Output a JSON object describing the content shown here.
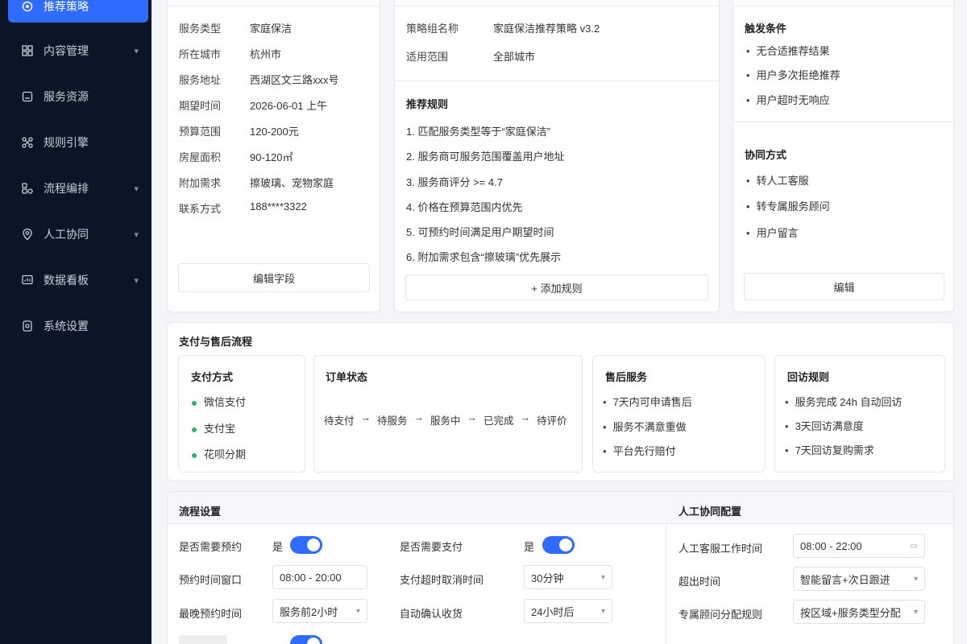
{
  "sidebar": {
    "active": {
      "label": "推荐策略",
      "icon": "strategy-icon"
    },
    "items": [
      {
        "label": "内容管理",
        "icon": "grid-icon",
        "has_children": true
      },
      {
        "label": "服务资源",
        "icon": "resource-icon",
        "has_children": false
      },
      {
        "label": "规则引擎",
        "icon": "rule-engine-icon",
        "has_children": false
      },
      {
        "label": "流程编排",
        "icon": "flow-icon",
        "has_children": true
      },
      {
        "label": "人工协同",
        "icon": "location-icon",
        "has_children": true
      },
      {
        "label": "数据看板",
        "icon": "dashboard-icon",
        "has_children": true
      },
      {
        "label": "系统设置",
        "icon": "settings-icon",
        "has_children": false
      }
    ]
  },
  "request": {
    "fields": [
      {
        "k": "服务类型",
        "v": "家庭保洁"
      },
      {
        "k": "所在城市",
        "v": "杭州市"
      },
      {
        "k": "服务地址",
        "v": "西湖区文三路xxx号"
      },
      {
        "k": "期望时间",
        "v": "2026-06-01 上午"
      },
      {
        "k": "预算范围",
        "v": "120-200元"
      },
      {
        "k": "房屋面积",
        "v": "90-120㎡"
      },
      {
        "k": "附加需求",
        "v": "擦玻璃、宠物家庭"
      },
      {
        "k": "联系方式",
        "v": "188****3322"
      }
    ],
    "edit_button": "编辑字段"
  },
  "strategy": {
    "name_label": "策略组名称",
    "name_value": "家庭保洁推荐策略 v3.2",
    "scope_label": "适用范围",
    "scope_value": "全部城市",
    "rules_title": "推荐规则",
    "rules": [
      "1. 匹配服务类型等于“家庭保洁”",
      "2. 服务商可服务范围覆盖用户地址",
      "3. 服务商评分 >= 4.7",
      "4. 价格在预算范围内优先",
      "5. 可预约时间满足用户期望时间",
      "6. 附加需求包含“擦玻璃”优先展示"
    ],
    "add_rule_button": "+ 添加规则"
  },
  "trigger": {
    "title": "触发条件",
    "items": [
      "无合适推荐结果",
      "用户多次拒绝推荐",
      "用户超时无响应"
    ],
    "coop_title": "协同方式",
    "coop_items": [
      "转人工客服",
      "转专属服务顾问",
      "用户留言"
    ],
    "edit_button": "编辑"
  },
  "payment_section": {
    "title": "支付与售后流程",
    "payment": {
      "title": "支付方式",
      "items": [
        "微信支付",
        "支付宝",
        "花呗分期"
      ]
    },
    "order": {
      "title": "订单状态",
      "steps": [
        "待支付",
        "待服务",
        "服务中",
        "已完成",
        "待评价"
      ]
    },
    "after_sales": {
      "title": "售后服务",
      "items": [
        "7天内可申请售后",
        "服务不满意重做",
        "平台先行赔付"
      ]
    },
    "revisit": {
      "title": "回访规则",
      "items": [
        "服务完成 24h 自动回访",
        "3天回访满意度",
        "7天回访复购需求"
      ]
    }
  },
  "flow_settings": {
    "title": "流程设置",
    "rows": [
      {
        "label": "是否需要预约",
        "type": "toggle",
        "prefix": "是"
      },
      {
        "label": "预约时间窗口",
        "type": "input",
        "value": "08:00 - 20:00"
      },
      {
        "label": "最晚预约时间",
        "type": "select",
        "value": "服务前2小时"
      }
    ],
    "rows_right": [
      {
        "label": "是否需要支付",
        "type": "toggle",
        "prefix": "是"
      },
      {
        "label": "支付超时取消时间",
        "type": "select",
        "value": "30分钟"
      },
      {
        "label": "自动确认收货",
        "type": "select",
        "value": "24小时后"
      }
    ]
  },
  "manual_config": {
    "title": "人工协同配置",
    "rows": [
      {
        "label": "人工客服工作时间",
        "value": "08:00 - 22:00",
        "icon": "calendar-icon"
      },
      {
        "label": "超出时间",
        "value": "智能留言+次日跟进"
      },
      {
        "label": "专属顾问分配规则",
        "value": "按区域+服务类型分配"
      }
    ]
  }
}
